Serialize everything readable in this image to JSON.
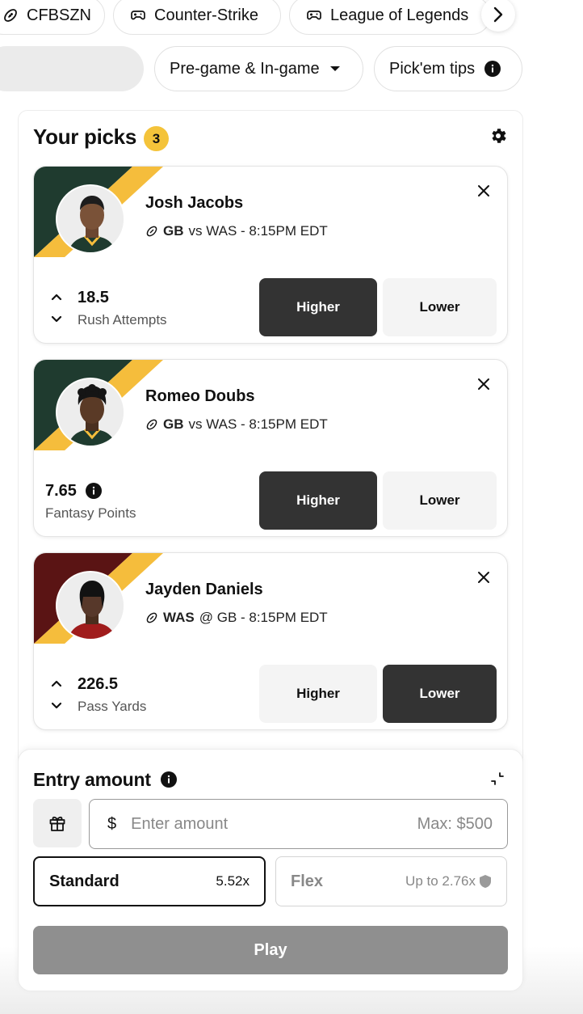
{
  "top_chips": [
    {
      "label": "CFBSZN",
      "icon": "football-icon"
    },
    {
      "label": "Counter-Strike",
      "icon": "gamepad-icon"
    },
    {
      "label": "League of Legends",
      "icon": "gamepad-icon"
    }
  ],
  "filters": {
    "game_time": "Pre-game & In-game",
    "tips": "Pick'em tips"
  },
  "picks": {
    "title": "Your picks",
    "count": "3",
    "cards": [
      {
        "player": "Josh Jacobs",
        "team": "GB",
        "rest": "vs WAS - 8:15PM EDT",
        "line": "18.5",
        "stat": "Rush Attempts",
        "selected": "Higher",
        "higher_label": "Higher",
        "lower_label": "Lower",
        "team_color": "#1f3b2f",
        "accent_color": "#f5bd3c"
      },
      {
        "player": "Romeo Doubs",
        "team": "GB",
        "rest": "vs WAS - 8:15PM EDT",
        "line": "7.65",
        "stat": "Fantasy Points",
        "selected": "Higher",
        "higher_label": "Higher",
        "lower_label": "Lower",
        "team_color": "#1f3b2f",
        "accent_color": "#f5bd3c"
      },
      {
        "player": "Jayden Daniels",
        "team": "WAS",
        "rest": "@ GB - 8:15PM EDT",
        "line": "226.5",
        "stat": "Pass Yards",
        "selected": "Lower",
        "higher_label": "Higher",
        "lower_label": "Lower",
        "team_color": "#5a1414",
        "accent_color": "#f5bd3c"
      }
    ]
  },
  "entry": {
    "title": "Entry amount",
    "currency": "$",
    "placeholder": "Enter amount",
    "max_label": "Max: $500",
    "standard_label": "Standard",
    "standard_mult": "5.52x",
    "flex_label": "Flex",
    "flex_mult": "Up to 2.76x",
    "play_label": "Play"
  }
}
